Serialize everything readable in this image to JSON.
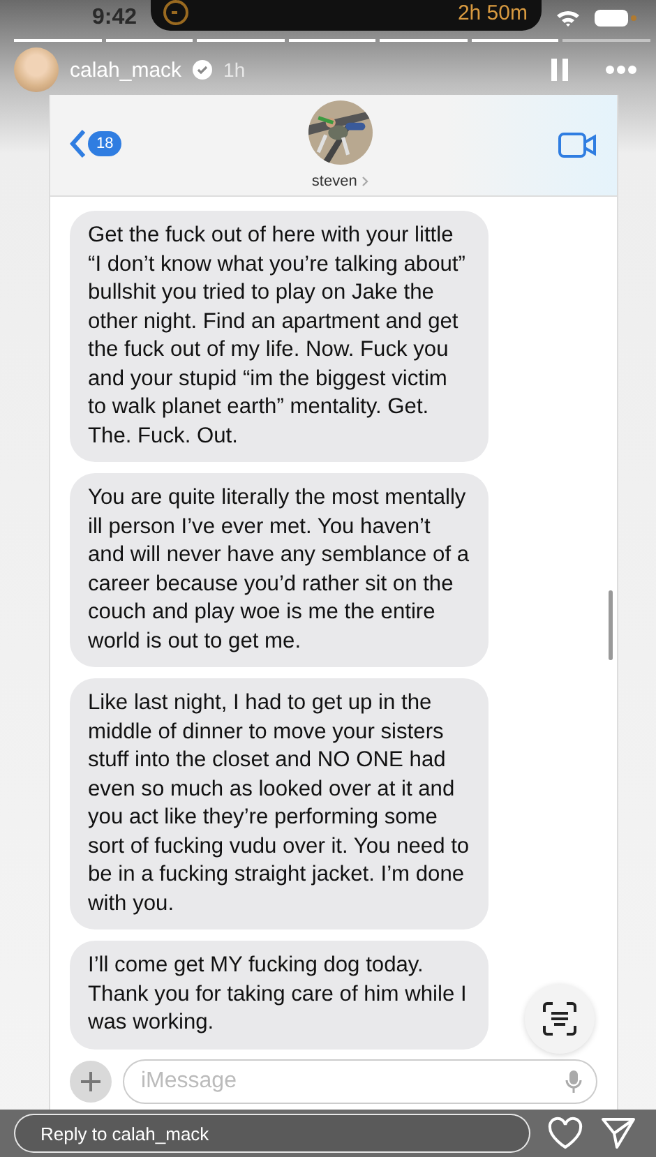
{
  "status_bar": {
    "time": "9:42",
    "timer": "2h 50m"
  },
  "story_progress": [
    {
      "level": 1
    },
    {
      "level": 1
    },
    {
      "level": 1
    },
    {
      "level": 1
    },
    {
      "level": 1
    },
    {
      "level": 1
    },
    {
      "level": 0
    }
  ],
  "story_header": {
    "username": "calah_mack",
    "verified": true,
    "age": "1h",
    "paused": true
  },
  "chat": {
    "back_count": "18",
    "contact": "steven",
    "messages": [
      {
        "text": "Get the fuck out of here with your little “I don’t know what you’re talking about” bullshit you tried to play on Jake the other night. Find an apartment and get the fuck out of my life. Now. Fuck you and your stupid “im the biggest victim to walk planet earth” mentality. Get. The. Fuck. Out."
      },
      {
        "text": "You are quite literally the most mentally ill person I’ve ever met. You haven’t and will never have any semblance of a career because you’d rather sit on the couch and play woe is me the entire world is out to get me."
      },
      {
        "text": "Like last night, I had to get up in the middle of dinner to move your sisters stuff into the closet and NO ONE had even so much as looked over at it and you act like they’re performing some sort of fucking vudu over it. You need to be in a fucking straight jacket. I’m done with you."
      },
      {
        "text": "I’ll come get MY fucking dog today. Thank you for taking care of him while I was working."
      }
    ],
    "input": {
      "placeholder": "iMessage"
    }
  },
  "reply": {
    "placeholder": "Reply to calah_mack"
  }
}
